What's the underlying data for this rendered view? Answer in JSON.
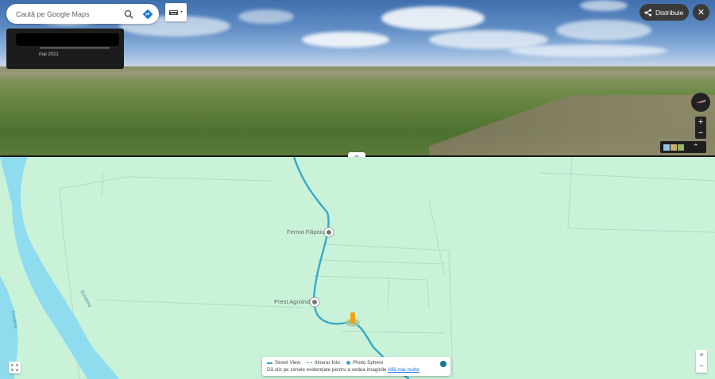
{
  "search": {
    "placeholder": "Caută pe Google Maps"
  },
  "info_card": {
    "date": "mai 2021"
  },
  "share": {
    "label": "Distribuie"
  },
  "street_view_zoom": {
    "in": "+",
    "out": "−"
  },
  "map": {
    "pois": [
      {
        "label": "Ferma Filipoiu"
      },
      {
        "label": "Prest Agroind"
      }
    ],
    "river_labels": [
      "Dunărea",
      "Dunărea"
    ]
  },
  "legend": {
    "items": [
      {
        "label": "Street View",
        "icon": "line-icon"
      },
      {
        "label": "Itinerar foto",
        "icon": "dashed-line-icon"
      },
      {
        "label": "Photo Sphere",
        "icon": "dot-icon"
      }
    ],
    "hint": "Dă clic pe zonele evidențiate pentru a vedea imaginile",
    "link": "Află mai multe"
  },
  "map_zoom": {
    "in": "+",
    "out": "−"
  },
  "colors": {
    "route": "#36a9c9",
    "map_bg": "#c9f2d9",
    "river": "#8fdcef",
    "link": "#1a73e8"
  }
}
